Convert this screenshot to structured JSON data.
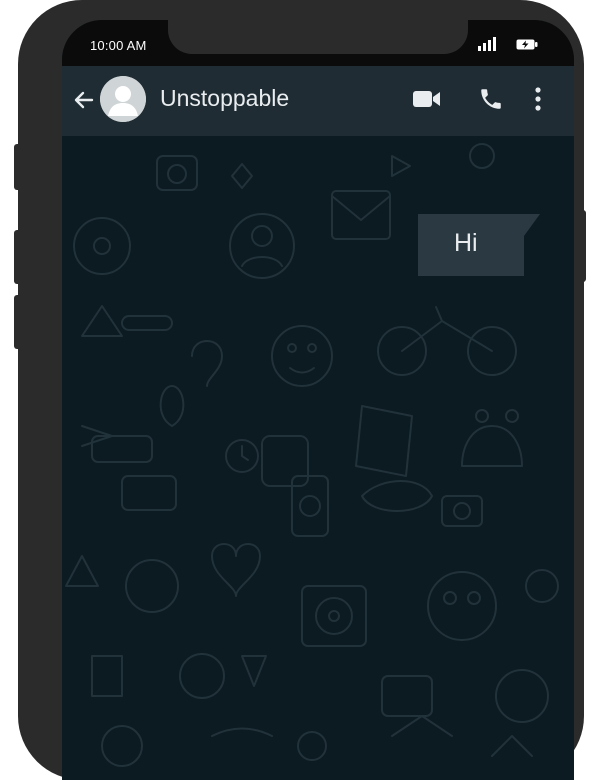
{
  "status_bar": {
    "time": "10:00 AM",
    "signal_icon": "signal-bars-icon",
    "battery_icon": "battery-charging-icon"
  },
  "header": {
    "contact_name": "Unstoppable",
    "icons": [
      "back-arrow-icon",
      "avatar-icon",
      "video-call-icon",
      "voice-call-icon",
      "more-options-icon"
    ]
  },
  "messages": [
    {
      "direction": "outgoing",
      "text": "Hi"
    }
  ],
  "colors": {
    "chat_background": "#0c1a21",
    "header_background": "#1f2c33",
    "outgoing_bubble": "#2a3942",
    "text_primary": "#e9edef"
  }
}
